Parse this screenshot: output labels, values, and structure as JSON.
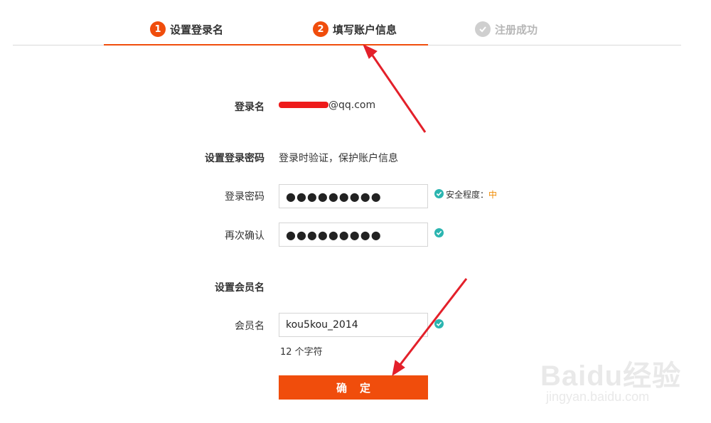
{
  "steps": [
    {
      "num": "1",
      "label": "设置登录名"
    },
    {
      "num": "2",
      "label": "填写账户信息"
    },
    {
      "label": "注册成功"
    }
  ],
  "login": {
    "label": "登录名",
    "email_suffix": "@qq.com"
  },
  "password_section": {
    "label": "设置登录密码",
    "hint": "登录时验证，保护账户信息"
  },
  "password": {
    "label": "登录密码",
    "value": "●●●●●●●●●",
    "strength_label": "安全程度：",
    "strength_value": "中"
  },
  "confirm": {
    "label": "再次确认",
    "value": "●●●●●●●●●"
  },
  "member_section": {
    "label": "设置会员名"
  },
  "member": {
    "label": "会员名",
    "value": "kou5kou_2014",
    "count": "12 个字符"
  },
  "submit_label": "确定",
  "watermark": {
    "main": "Baidu经验",
    "sub": "jingyan.baidu.com"
  },
  "colors": {
    "accent": "#f04d0c",
    "check": "#2bb5b0",
    "arrow": "#e3202a"
  }
}
